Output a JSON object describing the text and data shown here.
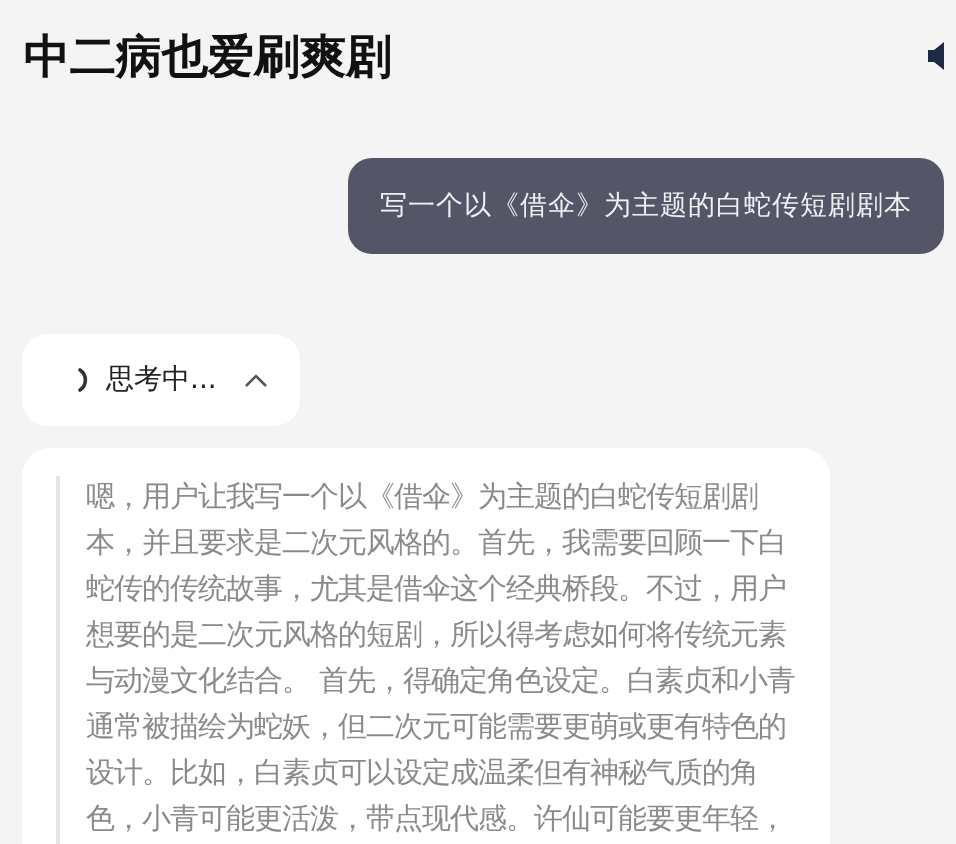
{
  "header": {
    "title": "中二病也爱刷爽剧"
  },
  "user_message": {
    "text": "写一个以《借伞》为主题的白蛇传短剧剧本"
  },
  "thinking": {
    "label": "思考中...",
    "expanded": true
  },
  "reasoning": {
    "lines": [
      "嗯，用户让我写一个以《借伞》为主题的白蛇传短剧剧",
      "本，并且要求是二次元风格的。首先，我需要回顾一下白",
      "蛇传的传统故事，尤其是借伞这个经典桥段。不过，用户",
      "想要的是二次元风格的短剧，所以得考虑如何将传统元素",
      "与动漫文化结合。 首先，得确定角色设定。白素贞和小青",
      "通常被描绘为蛇妖，但二次元可能需要更萌或更有特色的",
      "设计。比如，白素贞可以设定成温柔但有神秘气质的角",
      "色，小青可能更活泼，带点现代感。许仙可能要更年轻，"
    ]
  }
}
